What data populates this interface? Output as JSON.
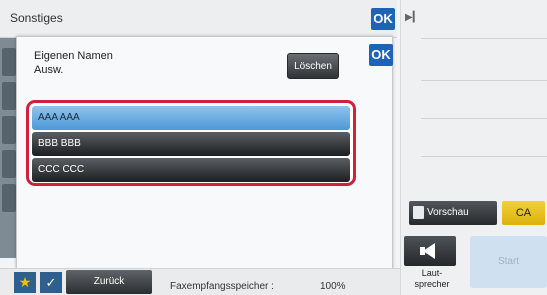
{
  "titlebar": {
    "title": "Sonstiges",
    "ok_label": "OK"
  },
  "dialog": {
    "label_line1": "Eigenen Namen",
    "label_line2": "Ausw.",
    "ok_label": "OK",
    "delete_label": "Löschen",
    "names": [
      "AAA AAA",
      "BBB BBB",
      "CCC CCC"
    ],
    "selected_index": 0
  },
  "bottombar": {
    "back_label": "Zurück",
    "memory_label": "Faxempfangsspeicher :",
    "memory_value": "100%"
  },
  "rightpanel": {
    "preview_label": "Vorschau",
    "ca_label": "CA",
    "speaker_label_line1": "Laut-",
    "speaker_label_line2": "sprecher",
    "start_label": "Start"
  },
  "colors": {
    "accent_blue": "#1f63b5",
    "highlight_red": "#d31f3e",
    "selected_item": "#6aaee3",
    "ca_yellow": "#e8c020"
  }
}
